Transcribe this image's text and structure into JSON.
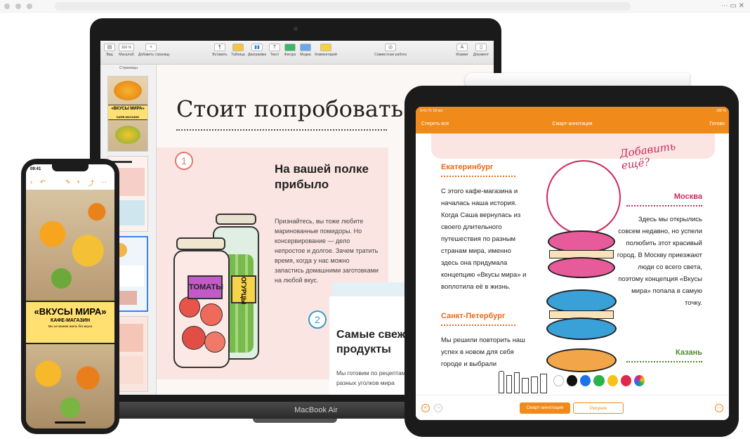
{
  "mac": {
    "label": "MacBook Air",
    "toolbar": {
      "zoom": "300 %",
      "items": [
        "Вид",
        "Масштаб",
        "Добавить страницу",
        "Вставить",
        "Таблица",
        "Диаграмма",
        "Текст",
        "Фигура",
        "Медиа",
        "Комментарий",
        "Совместная работа",
        "Формат",
        "Документ"
      ]
    },
    "pages_title": "Страницы",
    "thumb_title": "«ВКУСЫ МИРА»",
    "thumb_sub": "КАФЕ-МАГАЗИН",
    "doc": {
      "title": "Стоит попробовать",
      "num1": "1",
      "heading1": "На вашей полке прибыло",
      "body1": "Признайтесь, вы тоже любите маринованные помидоры. Но консервирование — дело непростое и долгое. Зачем тратить время, когда у нас можно запастись домашними заготовками на любой вкус.",
      "jar_label": "ТОМАТЫ",
      "jar2_label": "ОГУРЦЫ",
      "num2": "2",
      "heading2": "Самые свежие продукты",
      "body2": "Мы готовим по рецептам из разных уголков мира"
    }
  },
  "ipad": {
    "status_time": "9:41  Пт 18 окт.",
    "status_right": "100 %",
    "nav_left": "Стереть все",
    "nav_title": "Смарт-аннотация",
    "nav_right": "Готово",
    "handwriting": "Добавить ещё?",
    "cities": [
      {
        "name": "Екатеринбург",
        "text": "С этого кафе-магазина и началась наша история. Когда Саша вернулась из своего длительного путешествия по разным странам мира, именно здесь она придумала концепцию «Вкусы мира» и воплотила её в жизнь."
      },
      {
        "name": "Санкт-Петербург",
        "text": "Мы решили повторить наш успех в новом для себя городе и выбрали"
      },
      {
        "name": "Москва",
        "text": "Здесь мы открылись совсем недавно, но успели полюбить этот красивый город. В Москву приезжают люди со всего света, поэтому концепция «Вкусы мира» попала в самую точку."
      },
      {
        "name": "Казань",
        "text": ""
      }
    ],
    "btn_smart": "Смарт-аннотации",
    "btn_draw": "Рисунок",
    "palette": [
      "#ffffff",
      "#111111",
      "#1a73e8",
      "#2bb34a",
      "#f6c21a",
      "#e0284a"
    ]
  },
  "iphone": {
    "time": "09:41",
    "banner_title": "«ВКУСЫ МИРА»",
    "banner_sub": "КАФЕ-МАГАЗИН",
    "banner_small": "Мы не можем жить без вкуса"
  }
}
